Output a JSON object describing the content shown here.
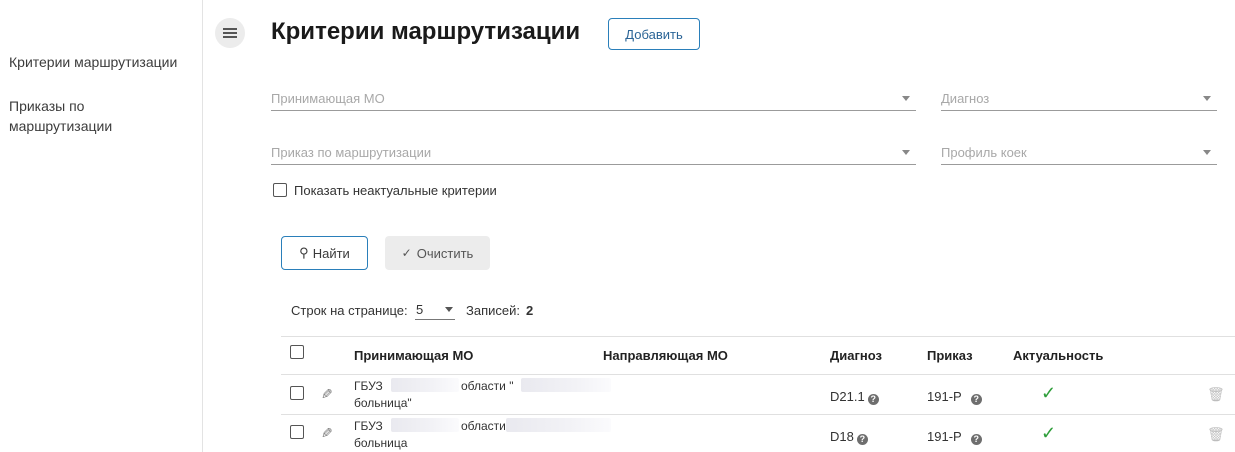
{
  "sidebar": {
    "items": [
      {
        "label": "Критерии маршрутизации"
      },
      {
        "label": "Приказы по\nмаршрутизации"
      }
    ]
  },
  "header": {
    "title": "Критерии маршрутизации",
    "add_label": "Добавить"
  },
  "filters": {
    "receiving_mo_placeholder": "Принимающая МО",
    "diagnosis_placeholder": "Диагноз",
    "order_placeholder": "Приказ по маршрутизации",
    "bed_profile_placeholder": "Профиль коек",
    "show_inactive_label": "Показать неактуальные критерии"
  },
  "actions": {
    "find_label": "Найти",
    "clear_label": "Очистить"
  },
  "pagination": {
    "rows_label": "Строк на странице:",
    "rows_value": "5",
    "records_label": "Записей:",
    "records_value": "2"
  },
  "table": {
    "columns": [
      "Принимающая МО",
      "Направляющая МО",
      "Диагноз",
      "Приказ",
      "Актуальность"
    ],
    "rows": [
      {
        "mo_line1_a": "ГБУЗ",
        "mo_line1_b": "области \"",
        "mo_line2": "больница\"",
        "diagnosis": "D21.1",
        "order": "191-Р"
      },
      {
        "mo_line1_a": "ГБУЗ",
        "mo_line1_b": "области",
        "mo_line2": "больница",
        "diagnosis": "D18",
        "order": "191-Р"
      }
    ]
  },
  "colors": {
    "accent": "#2a7fba",
    "success": "#2e9e3a"
  }
}
